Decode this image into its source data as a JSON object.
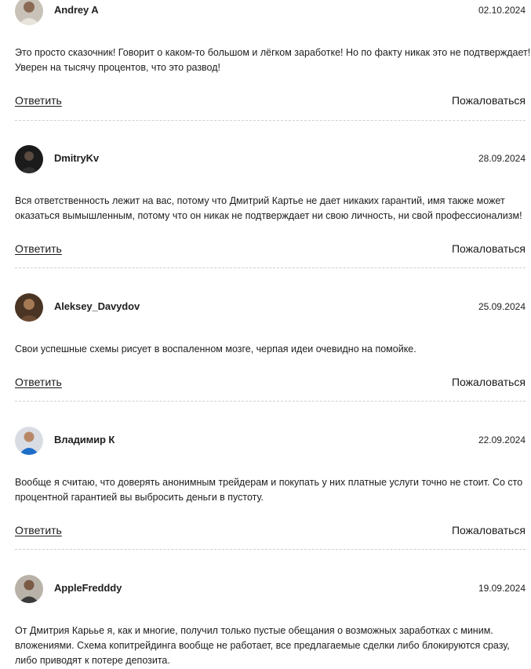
{
  "comments": [
    {
      "author": "Andrey A",
      "date": "02.10.2024",
      "avatar": "user-avatar-icon",
      "text": "Это просто сказочник! Говорит о каком-то большом и лёгком заработке! Но по факту никак это не подтверждает! Уверен на тысячу процентов, что это развод!",
      "reply_label": "Ответить",
      "report_label": "Пожаловаться"
    },
    {
      "author": "DmitryKv",
      "date": "28.09.2024",
      "avatar": "user-avatar-icon",
      "text": "Вся ответственность лежит на вас, потому что Дмитрий Картье не дает никаких гарантий, имя также может оказаться вымышленным, потому что он никак не подтверждает ни свою личность, ни свой профессионализм!",
      "reply_label": "Ответить",
      "report_label": "Пожаловаться"
    },
    {
      "author": "Aleksey_Davydov",
      "date": "25.09.2024",
      "avatar": "user-avatar-icon",
      "text": "Свои успешные схемы рисует в воспаленном мозге, черпая идеи очевидно на помойке.",
      "reply_label": "Ответить",
      "report_label": "Пожаловаться"
    },
    {
      "author": "Владимир К",
      "date": "22.09.2024",
      "avatar": "user-avatar-icon",
      "text": "Вообще я считаю, что доверять анонимным трейдерам и покупать у них платные услуги точно не стоит. Со сто процентной гарантией вы выбросить деньги в пустоту.",
      "reply_label": "Ответить",
      "report_label": "Пожаловаться"
    },
    {
      "author": "AppleFredddy",
      "date": "19.09.2024",
      "avatar": "user-avatar-icon",
      "text": "От Дмитрия Карьье я, как и многие, получил только пустые обещания о возможных заработках с миним. вложениями. Схема копитрейдинга вообще не работает, все предлагаемые сделки либо блокируются сразу, либо приводят к потере депозита."
    }
  ]
}
